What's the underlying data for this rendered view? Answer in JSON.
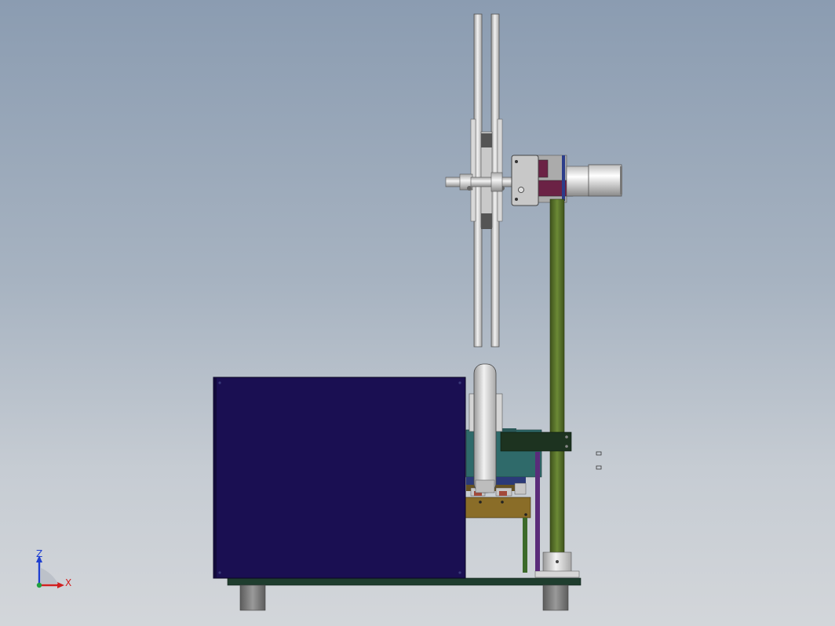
{
  "triad": {
    "z_label": "Z",
    "x_label": "X"
  },
  "colors": {
    "background_top": "#8b9cb1",
    "background_bottom": "#d3d6da",
    "cabinet": "#1a0f52",
    "pole": "#56702a",
    "motor_bracket": "#6b2245",
    "bracket_dark": "#1d3320",
    "teal_block": "#2f6a6a",
    "bronze_block": "#8a6d28",
    "axis_z": "#1f3fd0",
    "axis_x": "#d02020",
    "axis_y": "#20a040"
  }
}
